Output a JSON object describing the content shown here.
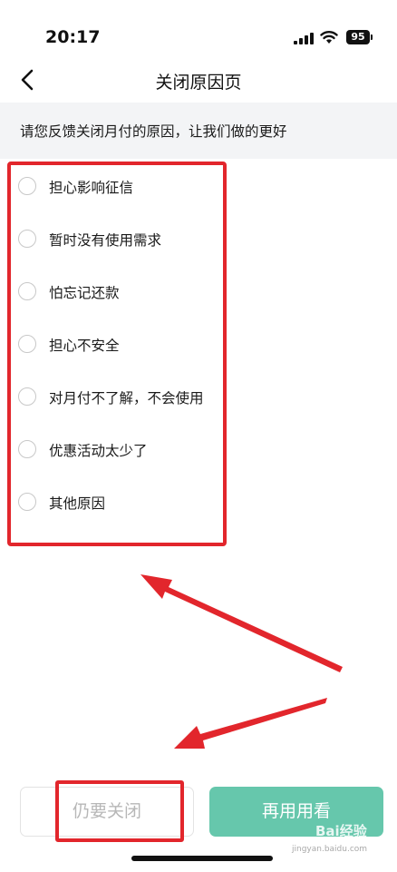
{
  "status_bar": {
    "time": "20:17",
    "battery": "95"
  },
  "nav": {
    "title": "关闭原因页",
    "back_icon": "chevron-left-icon"
  },
  "banner": {
    "text": "请您反馈关闭月付的原因，让我们做的更好"
  },
  "reasons": [
    {
      "label": "担心影响征信",
      "selected": false
    },
    {
      "label": "暂时没有使用需求",
      "selected": false
    },
    {
      "label": "怕忘记还款",
      "selected": false
    },
    {
      "label": "担心不安全",
      "selected": false
    },
    {
      "label": "对月付不了解，不会使用",
      "selected": false
    },
    {
      "label": "优惠活动太少了",
      "selected": false
    },
    {
      "label": "其他原因",
      "selected": false
    }
  ],
  "buttons": {
    "close_label": "仍要关闭",
    "keep_label": "再用用看"
  },
  "colors": {
    "accent": "#66c7ac",
    "highlight": "#e2262c",
    "banner_bg": "#f3f4f6"
  },
  "watermark": {
    "text": "Bai经验",
    "sub": "jingyan.baidu.com"
  }
}
